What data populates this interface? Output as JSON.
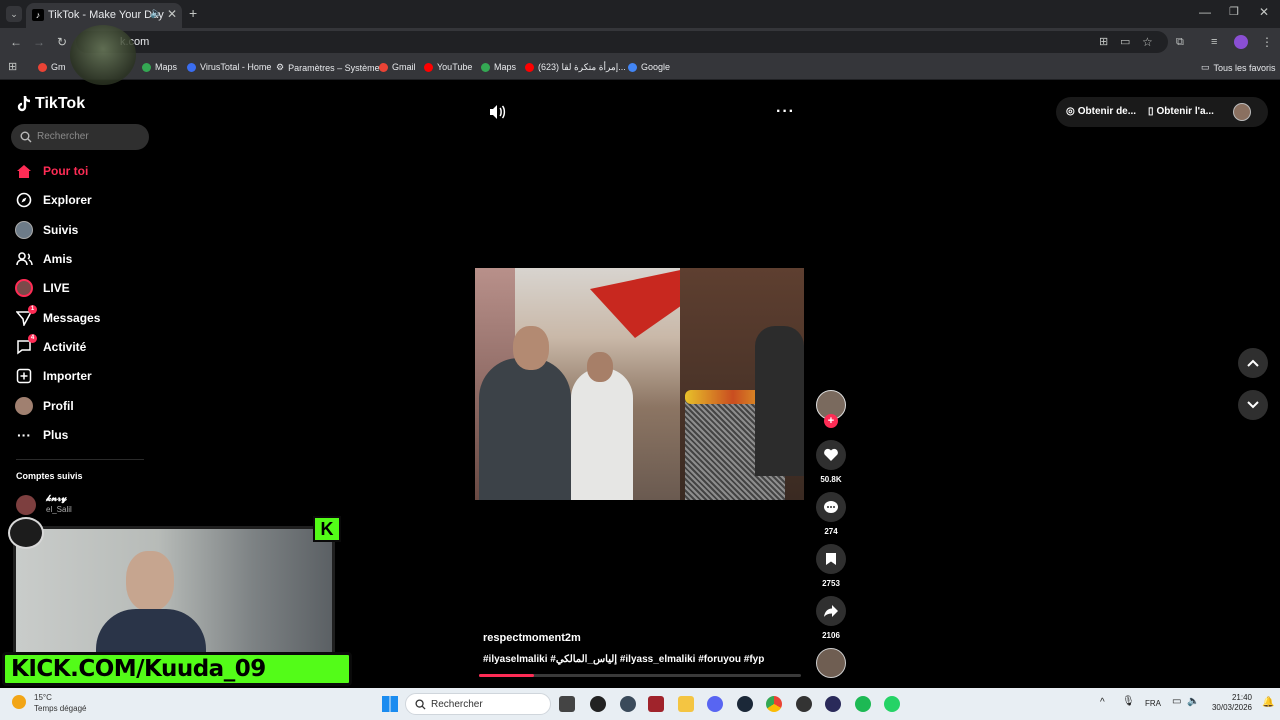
{
  "browser": {
    "tab_title": "TikTok - Make Your Day",
    "url": "k.com",
    "bookmarks": [
      "Gm",
      "Maps",
      "VirusTotal - Home",
      "Paramètres – Système",
      "Gmail",
      "YouTube",
      "Maps",
      "(623) إمرأة متكرة لقا...",
      "Google"
    ],
    "all_bookmarks": "Tous les favoris"
  },
  "tiktok": {
    "logo": "TikTok",
    "search_placeholder": "Rechercher",
    "nav": [
      {
        "label": "Pour toi",
        "icon": "home-icon"
      },
      {
        "label": "Explorer",
        "icon": "compass-icon"
      },
      {
        "label": "Suivis",
        "icon": "avatar-icon"
      },
      {
        "label": "Amis",
        "icon": "friends-icon"
      },
      {
        "label": "LIVE",
        "icon": "live-icon"
      },
      {
        "label": "Messages",
        "icon": "messages-icon",
        "badge": "1"
      },
      {
        "label": "Activité",
        "icon": "activity-icon",
        "badge": "4"
      },
      {
        "label": "Importer",
        "icon": "upload-icon"
      },
      {
        "label": "Profil",
        "icon": "profile-icon"
      },
      {
        "label": "Plus",
        "icon": "more-icon"
      }
    ],
    "followed_title": "Comptes suivis",
    "followed": [
      {
        "name": "𝓴𝓷𝓻𝔂",
        "handle": "el_Salil"
      }
    ],
    "topright": {
      "get_desktop": "Obtenir de...",
      "get_app": "Obtenir l'a..."
    },
    "video": {
      "username": "respectmoment2m",
      "tags": "#ilyaselmaliki #إلياس_المالكي #ilyass_elmaliki #foruyou #fyp",
      "progress": 0.17
    },
    "actions": {
      "likes": "50.8K",
      "comments": "274",
      "saves": "2753",
      "shares": "2106"
    }
  },
  "stream_overlay": {
    "kick": "KICK.COM/Kuuda_09"
  },
  "taskbar": {
    "temp": "15°C",
    "weather": "Temps dégagé",
    "search_placeholder": "Rechercher",
    "lang": "FRA",
    "time": "21:40",
    "date": "30/03/2026"
  }
}
